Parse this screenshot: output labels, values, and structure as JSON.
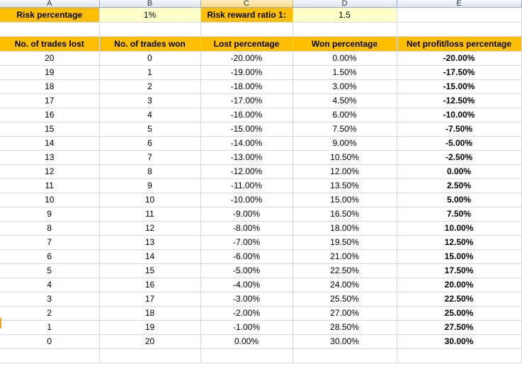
{
  "columns": [
    "A",
    "B",
    "C",
    "D",
    "E"
  ],
  "settings": {
    "risk_label": "Risk percentage",
    "risk_value": "1%",
    "rr_label": "Risk reward ratio 1:",
    "rr_value": "1.5"
  },
  "headers": [
    "No. of trades lost",
    "No. of trades won",
    "Lost percentage",
    "Won percentage",
    "Net profit/loss percentage"
  ],
  "rows": [
    {
      "lost": "20",
      "won": "0",
      "lostp": "-20.00%",
      "wonp": "0.00%",
      "net": "-20.00%"
    },
    {
      "lost": "19",
      "won": "1",
      "lostp": "-19.00%",
      "wonp": "1.50%",
      "net": "-17.50%"
    },
    {
      "lost": "18",
      "won": "2",
      "lostp": "-18.00%",
      "wonp": "3.00%",
      "net": "-15.00%"
    },
    {
      "lost": "17",
      "won": "3",
      "lostp": "-17.00%",
      "wonp": "4.50%",
      "net": "-12.50%"
    },
    {
      "lost": "16",
      "won": "4",
      "lostp": "-16.00%",
      "wonp": "6.00%",
      "net": "-10.00%"
    },
    {
      "lost": "15",
      "won": "5",
      "lostp": "-15.00%",
      "wonp": "7.50%",
      "net": "-7.50%"
    },
    {
      "lost": "14",
      "won": "6",
      "lostp": "-14.00%",
      "wonp": "9.00%",
      "net": "-5.00%"
    },
    {
      "lost": "13",
      "won": "7",
      "lostp": "-13.00%",
      "wonp": "10.50%",
      "net": "-2.50%"
    },
    {
      "lost": "12",
      "won": "8",
      "lostp": "-12.00%",
      "wonp": "12.00%",
      "net": "0.00%"
    },
    {
      "lost": "11",
      "won": "9",
      "lostp": "-11.00%",
      "wonp": "13.50%",
      "net": "2.50%"
    },
    {
      "lost": "10",
      "won": "10",
      "lostp": "-10.00%",
      "wonp": "15.00%",
      "net": "5.00%"
    },
    {
      "lost": "9",
      "won": "11",
      "lostp": "-9.00%",
      "wonp": "16.50%",
      "net": "7.50%"
    },
    {
      "lost": "8",
      "won": "12",
      "lostp": "-8.00%",
      "wonp": "18.00%",
      "net": "10.00%"
    },
    {
      "lost": "7",
      "won": "13",
      "lostp": "-7.00%",
      "wonp": "19.50%",
      "net": "12.50%"
    },
    {
      "lost": "6",
      "won": "14",
      "lostp": "-6.00%",
      "wonp": "21.00%",
      "net": "15.00%"
    },
    {
      "lost": "5",
      "won": "15",
      "lostp": "-5.00%",
      "wonp": "22.50%",
      "net": "17.50%"
    },
    {
      "lost": "4",
      "won": "16",
      "lostp": "-4.00%",
      "wonp": "24.00%",
      "net": "20.00%"
    },
    {
      "lost": "3",
      "won": "17",
      "lostp": "-3.00%",
      "wonp": "25.50%",
      "net": "22.50%"
    },
    {
      "lost": "2",
      "won": "18",
      "lostp": "-2.00%",
      "wonp": "27.00%",
      "net": "25.00%"
    },
    {
      "lost": "1",
      "won": "19",
      "lostp": "-1.00%",
      "wonp": "28.50%",
      "net": "27.50%"
    },
    {
      "lost": "0",
      "won": "20",
      "lostp": "0.00%",
      "wonp": "30.00%",
      "net": "30.00%"
    }
  ]
}
